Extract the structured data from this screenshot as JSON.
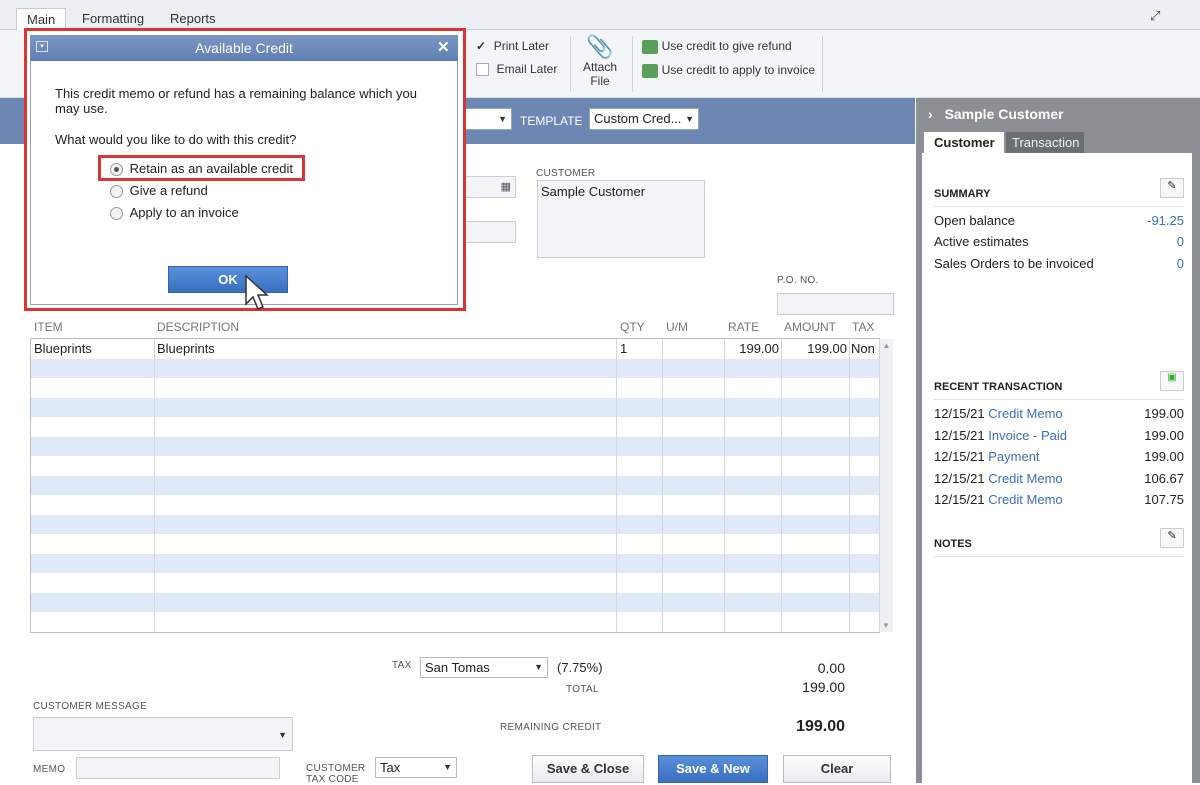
{
  "tabs": [
    "Main",
    "Formatting",
    "Reports"
  ],
  "toolbar": {
    "print_later": "Print Later",
    "email_later": "Email Later",
    "attach_1": "Attach",
    "attach_2": "File",
    "use_credit_refund": "Use credit to give refund",
    "use_credit_invoice": "Use credit to apply to invoice"
  },
  "header": {
    "template_label": "TEMPLATE",
    "template_value": "Custom Cred...",
    "customer_label": "CUSTOMER",
    "customer_value": "Sample Customer",
    "po_label": "P.O. NO."
  },
  "dialog": {
    "title": "Available Credit",
    "message_1": "This credit memo or refund has a remaining balance which you",
    "message_2": "may use.",
    "question": "What would you like to do with this credit?",
    "options": [
      "Retain as an available credit",
      "Give a refund",
      "Apply to an invoice"
    ],
    "selected": "Retain as an available credit",
    "ok": "OK"
  },
  "grid": {
    "headers": [
      "ITEM",
      "DESCRIPTION",
      "QTY",
      "U/M",
      "RATE",
      "AMOUNT",
      "TAX"
    ],
    "rows": [
      {
        "item": "Blueprints",
        "description": "Blueprints",
        "qty": "1",
        "um": "",
        "rate": "199.00",
        "amount": "199.00",
        "tax": "Non"
      }
    ]
  },
  "totals": {
    "tax_label": "TAX",
    "tax_district": "San Tomas",
    "tax_rate": "(7.75%)",
    "tax_amount": "0.00",
    "total_label": "TOTAL",
    "total_amount": "199.00",
    "remaining_label": "REMAINING CREDIT",
    "remaining_amount": "199.00"
  },
  "footer": {
    "customer_message_label": "CUSTOMER MESSAGE",
    "memo_label": "MEMO",
    "customer_tax_code_label_1": "CUSTOMER",
    "customer_tax_code_label_2": "TAX CODE",
    "tax_code_value": "Tax",
    "save_close": "Save & Close",
    "save_new": "Save & New",
    "clear": "Clear"
  },
  "panel": {
    "title": "Sample Customer",
    "tabs": [
      "Customer",
      "Transaction"
    ],
    "summary_label": "SUMMARY",
    "summary": [
      {
        "label": "Open balance",
        "value": "-91.25"
      },
      {
        "label": "Active estimates",
        "value": "0"
      },
      {
        "label": "Sales Orders to be invoiced",
        "value": "0"
      }
    ],
    "recent_label": "RECENT TRANSACTION",
    "recent": [
      {
        "date": "12/15/21",
        "type": "Credit Memo",
        "amount": "199.00"
      },
      {
        "date": "12/15/21",
        "type": "Invoice - Paid",
        "amount": "199.00"
      },
      {
        "date": "12/15/21",
        "type": "Payment",
        "amount": "199.00"
      },
      {
        "date": "12/15/21",
        "type": "Credit Memo",
        "amount": "106.67"
      },
      {
        "date": "12/15/21",
        "type": "Credit Memo",
        "amount": "107.75"
      }
    ],
    "notes_label": "NOTES"
  },
  "colors": {
    "accent": "#6d87b3",
    "link": "#3a6fc1",
    "highlight": "#dd3333"
  }
}
